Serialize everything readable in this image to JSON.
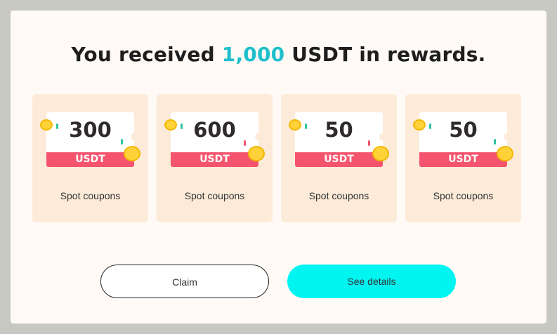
{
  "dialog": {
    "title_prefix": "You received ",
    "title_amount": "1,000",
    "title_suffix": " USDT in rewards."
  },
  "coupons": [
    {
      "value": "300",
      "currency": "USDT",
      "label": "Spot coupons"
    },
    {
      "value": "600",
      "currency": "USDT",
      "label": "Spot coupons"
    },
    {
      "value": "50",
      "currency": "USDT",
      "label": "Spot coupons"
    },
    {
      "value": "50",
      "currency": "USDT",
      "label": "Spot coupons"
    }
  ],
  "actions": {
    "claim_label": "Claim",
    "details_label": "See details"
  },
  "colors": {
    "accent": "#1fbfcc",
    "primary_button": "#00f5f1",
    "ticket_band": "#f5546e",
    "card_bg": "#fdebd9"
  }
}
